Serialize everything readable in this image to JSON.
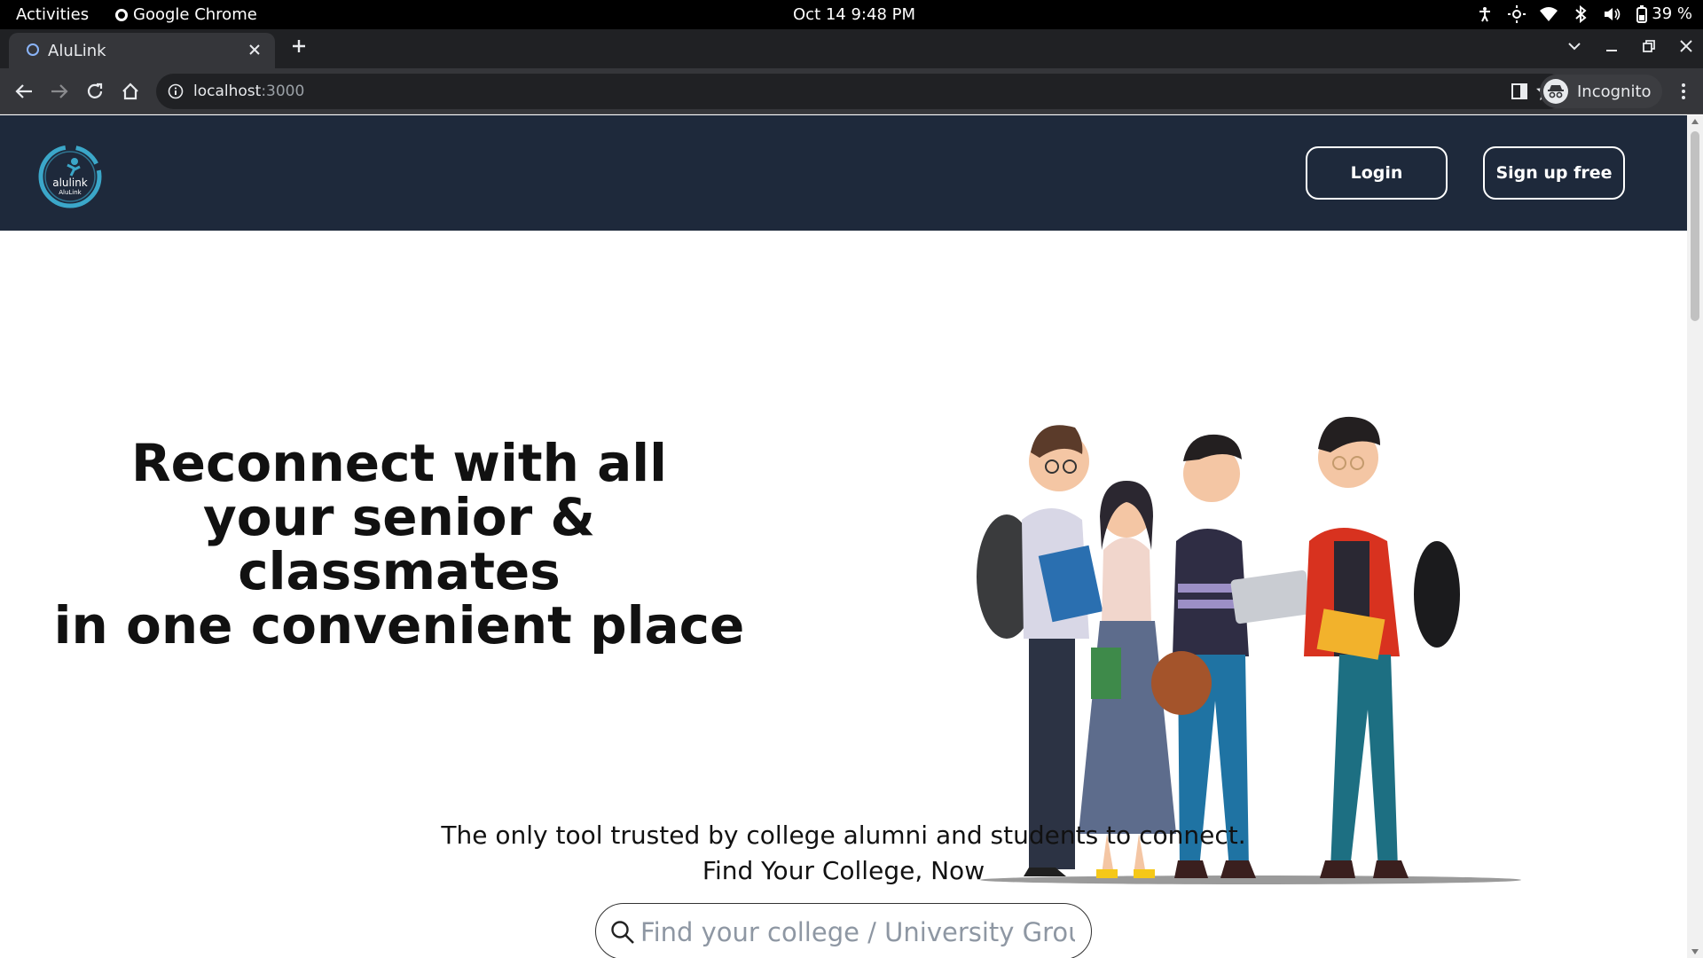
{
  "os": {
    "activities": "Activities",
    "app_name": "Google Chrome",
    "clock": "Oct 14  9:48 PM",
    "battery": "39 %"
  },
  "browser": {
    "tab_title": "AluLink",
    "url_host": "localhost",
    "url_port": ":3000",
    "profile_label": "Incognito"
  },
  "site": {
    "logo_text_main": "alulink",
    "logo_text_sub": "AluLink",
    "login_label": "Login",
    "signup_label": "Sign up free",
    "hero": {
      "line1": "Reconnect with all",
      "line2_a": "your senior ",
      "line2_amp": "&",
      "line2_b": " classmates",
      "line3": "in one convenient place"
    },
    "tagline": "The only tool trusted by college alumni and students to connect.",
    "subtagline": "Find Your College, Now",
    "search_placeholder": "Find your college / University Group"
  },
  "colors": {
    "header_bg": "#1e293b",
    "logo_accent": "#3ba7c9"
  }
}
